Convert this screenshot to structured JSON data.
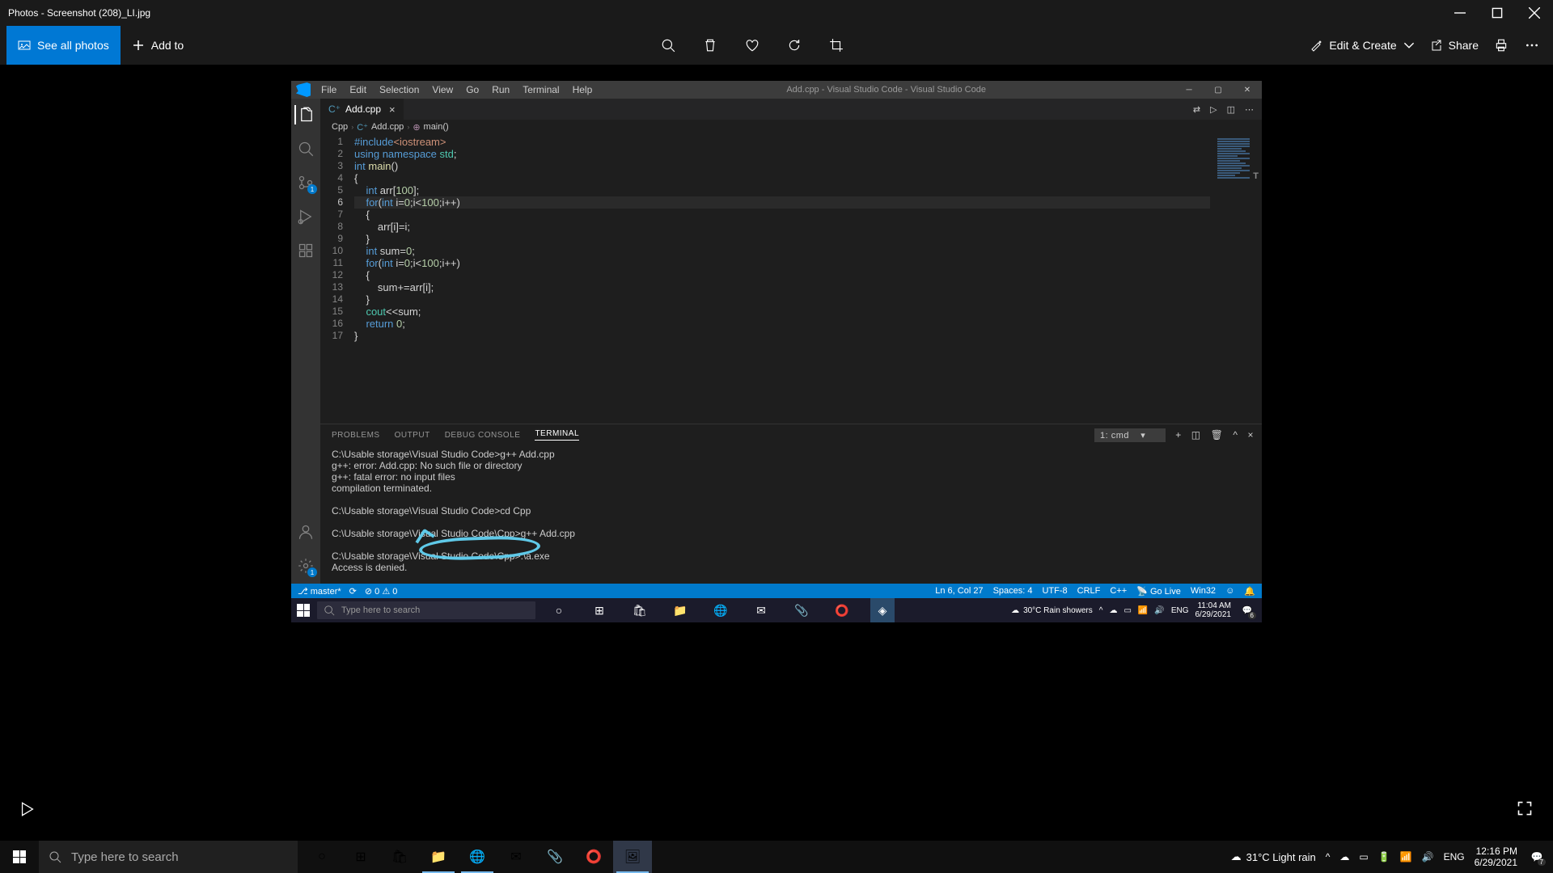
{
  "photos": {
    "title": "Photos - Screenshot (208)_LI.jpg",
    "seeAll": "See all photos",
    "addTo": "Add to",
    "editCreate": "Edit & Create",
    "share": "Share"
  },
  "vscode": {
    "menus": [
      "File",
      "Edit",
      "Selection",
      "View",
      "Go",
      "Run",
      "Terminal",
      "Help"
    ],
    "title": "Add.cpp - Visual Studio Code - Visual Studio Code",
    "tab": "Add.cpp",
    "breadcrumb": [
      "Cpp",
      "Add.cpp",
      "main()"
    ],
    "code": {
      "lines": [
        {
          "n": 1,
          "html": "<span class='kw'>#include</span><span class='str'>&lt;iostream&gt;</span>"
        },
        {
          "n": 2,
          "html": "<span class='kw'>using</span> <span class='kw'>namespace</span> <span class='ns'>std</span>;"
        },
        {
          "n": 3,
          "html": "<span class='type'>int</span> <span class='fn'>main</span>()"
        },
        {
          "n": 4,
          "html": "{"
        },
        {
          "n": 5,
          "html": "    <span class='type'>int</span> arr[<span class='num'>100</span>];"
        },
        {
          "n": 6,
          "html": "    <span class='kw'>for</span>(<span class='type'>int</span> i=<span class='num'>0</span>;i&lt;<span class='num'>100</span>;i++)",
          "current": true
        },
        {
          "n": 7,
          "html": "    {"
        },
        {
          "n": 8,
          "html": "        arr[i]=i;"
        },
        {
          "n": 9,
          "html": "    }"
        },
        {
          "n": 10,
          "html": "    <span class='type'>int</span> sum=<span class='num'>0</span>;"
        },
        {
          "n": 11,
          "html": "    <span class='kw'>for</span>(<span class='type'>int</span> i=<span class='num'>0</span>;i&lt;<span class='num'>100</span>;i++)"
        },
        {
          "n": 12,
          "html": "    {"
        },
        {
          "n": 13,
          "html": "        sum+=arr[i];"
        },
        {
          "n": 14,
          "html": "    }"
        },
        {
          "n": 15,
          "html": "    <span class='ns'>cout</span>&lt;&lt;sum;"
        },
        {
          "n": 16,
          "html": "    <span class='kw'>return</span> <span class='num'>0</span>;"
        },
        {
          "n": 17,
          "html": "}"
        }
      ]
    },
    "panelTabs": [
      "PROBLEMS",
      "OUTPUT",
      "DEBUG CONSOLE",
      "TERMINAL"
    ],
    "terminalSelect": "1: cmd",
    "terminal": "C:\\Usable storage\\Visual Studio Code>g++ Add.cpp\ng++: error: Add.cpp: No such file or directory\ng++: fatal error: no input files\ncompilation terminated.\n\nC:\\Usable storage\\Visual Studio Code>cd Cpp\n\nC:\\Usable storage\\Visual Studio Code\\Cpp>g++ Add.cpp\n\nC:\\Usable storage\\Visual Studio Code\\Cpp>.\\a.exe\nAccess is denied.\n\nC:\\Usable storage\\Visual Studio Code\\Cpp>",
    "status": {
      "branch": "master*",
      "errors": "0",
      "warnings": "0",
      "lncol": "Ln 6, Col 27",
      "spaces": "Spaces: 4",
      "encoding": "UTF-8",
      "eol": "CRLF",
      "lang": "C++",
      "golive": "Go Live",
      "win32": "Win32"
    }
  },
  "innerTaskbar": {
    "searchPlaceholder": "Type here to search",
    "weather": "30°C  Rain showers",
    "lang": "ENG",
    "time": "11:04 AM",
    "date": "6/29/2021",
    "notif": "6"
  },
  "outerTaskbar": {
    "searchPlaceholder": "Type here to search",
    "weather": "31°C  Light rain",
    "lang": "ENG",
    "time": "12:16 PM",
    "date": "6/29/2021",
    "notif": "7"
  }
}
